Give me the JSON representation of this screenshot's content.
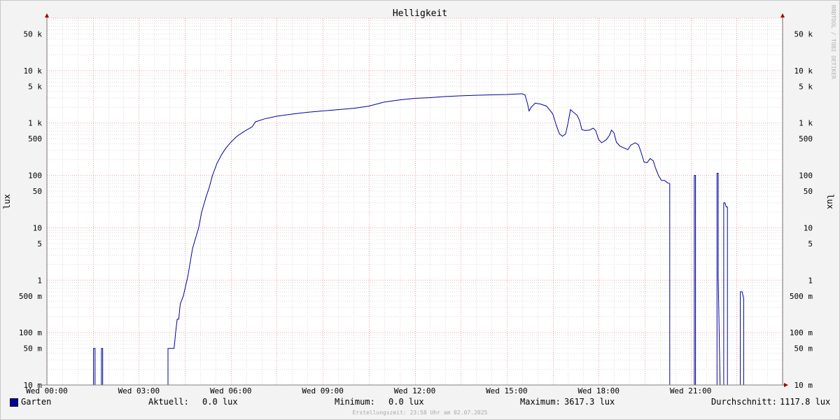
{
  "chart_data": {
    "type": "line",
    "title": "Helligkeit",
    "ylabel": "lux",
    "ylabel_right": "lux",
    "yscale": "log",
    "ylim": [
      0.01,
      100000
    ],
    "y_ticks": [
      {
        "value": 50000,
        "label": "50 k"
      },
      {
        "value": 10000,
        "label": "10 k"
      },
      {
        "value": 5000,
        "label": "5 k"
      },
      {
        "value": 1000,
        "label": "1 k"
      },
      {
        "value": 500,
        "label": "500"
      },
      {
        "value": 100,
        "label": "100"
      },
      {
        "value": 50,
        "label": "50"
      },
      {
        "value": 10,
        "label": "10"
      },
      {
        "value": 5,
        "label": "5"
      },
      {
        "value": 1,
        "label": "1"
      },
      {
        "value": 0.5,
        "label": "500 m"
      },
      {
        "value": 0.1,
        "label": "100 m"
      },
      {
        "value": 0.05,
        "label": "50 m"
      },
      {
        "value": 0.01,
        "label": "10 m"
      }
    ],
    "xlim": [
      0,
      24
    ],
    "x_ticks": [
      {
        "value": 0,
        "label": "Wed 00:00"
      },
      {
        "value": 3,
        "label": "Wed 03:00"
      },
      {
        "value": 6,
        "label": "Wed 06:00"
      },
      {
        "value": 9,
        "label": "Wed 09:00"
      },
      {
        "value": 12,
        "label": "Wed 12:00"
      },
      {
        "value": 15,
        "label": "Wed 15:00"
      },
      {
        "value": 18,
        "label": "Wed 18:00"
      },
      {
        "value": 21,
        "label": "Wed 21:00"
      }
    ],
    "grid": true,
    "series": [
      {
        "name": "Garten",
        "color": "#0000a0",
        "points": [
          [
            0,
            0.01
          ],
          [
            1.52,
            0.01
          ],
          [
            1.52,
            0.05
          ],
          [
            1.57,
            0.05
          ],
          [
            1.57,
            0.01
          ],
          [
            1.78,
            0.01
          ],
          [
            1.78,
            0.05
          ],
          [
            1.82,
            0.05
          ],
          [
            1.82,
            0.01
          ],
          [
            3.95,
            0.01
          ],
          [
            3.95,
            0.05
          ],
          [
            4.15,
            0.05
          ],
          [
            4.2,
            0.1
          ],
          [
            4.25,
            0.18
          ],
          [
            4.3,
            0.18
          ],
          [
            4.35,
            0.35
          ],
          [
            4.45,
            0.5
          ],
          [
            4.6,
            1.2
          ],
          [
            4.75,
            4
          ],
          [
            4.95,
            10
          ],
          [
            5.05,
            20
          ],
          [
            5.2,
            40
          ],
          [
            5.3,
            60
          ],
          [
            5.4,
            100
          ],
          [
            5.55,
            170
          ],
          [
            5.7,
            250
          ],
          [
            5.85,
            340
          ],
          [
            6.0,
            430
          ],
          [
            6.2,
            560
          ],
          [
            6.45,
            700
          ],
          [
            6.7,
            850
          ],
          [
            6.8,
            1050
          ],
          [
            7.1,
            1200
          ],
          [
            7.5,
            1350
          ],
          [
            8.0,
            1480
          ],
          [
            8.5,
            1600
          ],
          [
            9.0,
            1700
          ],
          [
            9.5,
            1800
          ],
          [
            10.0,
            1900
          ],
          [
            10.5,
            2100
          ],
          [
            11.0,
            2500
          ],
          [
            11.5,
            2750
          ],
          [
            12.0,
            2950
          ],
          [
            12.5,
            3050
          ],
          [
            13.0,
            3200
          ],
          [
            13.5,
            3300
          ],
          [
            14.0,
            3380
          ],
          [
            14.5,
            3450
          ],
          [
            15.0,
            3500
          ],
          [
            15.5,
            3617.3
          ],
          [
            15.6,
            3400
          ],
          [
            15.68,
            2300
          ],
          [
            15.73,
            1700
          ],
          [
            15.8,
            2000
          ],
          [
            15.93,
            2400
          ],
          [
            16.1,
            2300
          ],
          [
            16.3,
            2100
          ],
          [
            16.5,
            1500
          ],
          [
            16.62,
            900
          ],
          [
            16.72,
            620
          ],
          [
            16.82,
            560
          ],
          [
            16.92,
            620
          ],
          [
            17.0,
            1000
          ],
          [
            17.08,
            1800
          ],
          [
            17.15,
            1650
          ],
          [
            17.3,
            1400
          ],
          [
            17.38,
            1100
          ],
          [
            17.45,
            750
          ],
          [
            17.55,
            720
          ],
          [
            17.7,
            730
          ],
          [
            17.82,
            800
          ],
          [
            17.9,
            720
          ],
          [
            18.0,
            480
          ],
          [
            18.1,
            420
          ],
          [
            18.25,
            480
          ],
          [
            18.35,
            580
          ],
          [
            18.42,
            730
          ],
          [
            18.5,
            650
          ],
          [
            18.58,
            430
          ],
          [
            18.7,
            360
          ],
          [
            18.85,
            330
          ],
          [
            18.95,
            310
          ],
          [
            19.05,
            380
          ],
          [
            19.2,
            420
          ],
          [
            19.3,
            380
          ],
          [
            19.38,
            280
          ],
          [
            19.48,
            180
          ],
          [
            19.58,
            175
          ],
          [
            19.68,
            210
          ],
          [
            19.78,
            190
          ],
          [
            19.85,
            140
          ],
          [
            19.95,
            100
          ],
          [
            20.05,
            80
          ],
          [
            20.15,
            80
          ],
          [
            20.25,
            72
          ],
          [
            20.32,
            70
          ],
          [
            20.32,
            0.01
          ],
          [
            21.12,
            0.01
          ],
          [
            21.12,
            100
          ],
          [
            21.16,
            100
          ],
          [
            21.16,
            0.01
          ],
          [
            21.86,
            0.01
          ],
          [
            21.86,
            110
          ],
          [
            21.9,
            110
          ],
          [
            21.9,
            1.2
          ],
          [
            21.96,
            0.01
          ],
          [
            22.08,
            0.01
          ],
          [
            22.08,
            30
          ],
          [
            22.12,
            30
          ],
          [
            22.16,
            25
          ],
          [
            22.2,
            25
          ],
          [
            22.2,
            0.01
          ],
          [
            22.62,
            0.01
          ],
          [
            22.62,
            0.6
          ],
          [
            22.68,
            0.6
          ],
          [
            22.73,
            0.45
          ],
          [
            22.73,
            0.01
          ],
          [
            24,
            0.01
          ]
        ]
      }
    ]
  },
  "watermark": "RRDTOOL / TOBI OETIKER",
  "legend": {
    "series_name": "Garten",
    "current_label": "Aktuell:",
    "current_value": "0.0 lux",
    "min_label": "Minimum:",
    "min_value": "0.0 lux",
    "max_label": "Maximum:",
    "max_value": "3617.3 lux",
    "avg_label": "Durchschnitt:",
    "avg_value": "1117.8 lux"
  },
  "footer": "Erstellungszeit: 23:58 Uhr am 02.07.2025"
}
